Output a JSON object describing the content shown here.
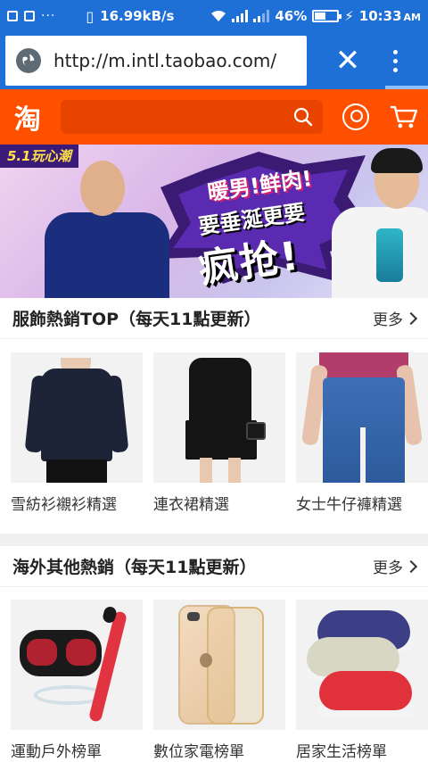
{
  "status_bar": {
    "network_speed": "16.99kB/s",
    "battery": "46%",
    "battery_level": 0.46,
    "time": "10:33",
    "ampm": "AM",
    "overflow": "···"
  },
  "browser": {
    "url": "http://m.intl.taobao.com/",
    "close_label": "✕"
  },
  "taobao": {
    "logo": "淘",
    "brand_color": "#ff5000"
  },
  "banner": {
    "tag": "5.1玩心潮",
    "line1": "暖男!鲜肉!",
    "line2": "要垂涎更要",
    "line3": "疯抢!"
  },
  "sections": [
    {
      "title": "服飾熱銷TOP（每天11點更新）",
      "more": "更多",
      "items": [
        {
          "label": "雪紡衫襯衫精選"
        },
        {
          "label": "連衣裙精選"
        },
        {
          "label": "女士牛仔褲精選"
        }
      ]
    },
    {
      "title": "海外其他熱銷（每天11點更新）",
      "more": "更多",
      "items": [
        {
          "label": "運動戶外榜單"
        },
        {
          "label": "數位家電榜單"
        },
        {
          "label": "居家生活榜單"
        }
      ]
    }
  ],
  "colors": {
    "browser_bar": "#1e6fd6",
    "accent": "#ff5000"
  },
  "icons": [
    "globe-icon",
    "close-icon",
    "more-vert-icon",
    "search-icon",
    "user-icon",
    "cart-icon"
  ]
}
